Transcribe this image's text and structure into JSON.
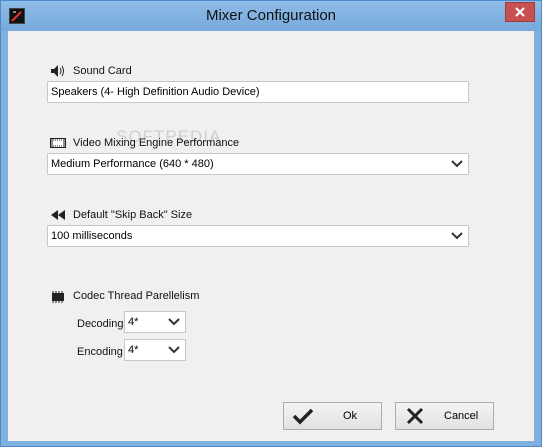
{
  "window": {
    "title": "Mixer Configuration",
    "watermark": "SOFTPEDIA"
  },
  "sound_card": {
    "label": "Sound Card",
    "value": "Speakers (4- High Definition Audio Device)"
  },
  "video_engine": {
    "label": "Video Mixing Engine Performance",
    "value": "Medium Performance (640 * 480)"
  },
  "skip_back": {
    "label": "Default \"Skip Back\" Size",
    "value": "100 milliseconds"
  },
  "codec": {
    "label": "Codec Thread Parellelism",
    "decoding_label": "Decoding",
    "decoding_value": "4*",
    "encoding_label": "Encoding",
    "encoding_value": "4*"
  },
  "buttons": {
    "ok": "Ok",
    "cancel": "Cancel"
  },
  "icons": [
    "app-icon",
    "close-icon",
    "speaker-icon",
    "film-icon",
    "rewind-icon",
    "chip-icon",
    "chevron-down-icon",
    "checkmark-icon",
    "x-icon"
  ]
}
